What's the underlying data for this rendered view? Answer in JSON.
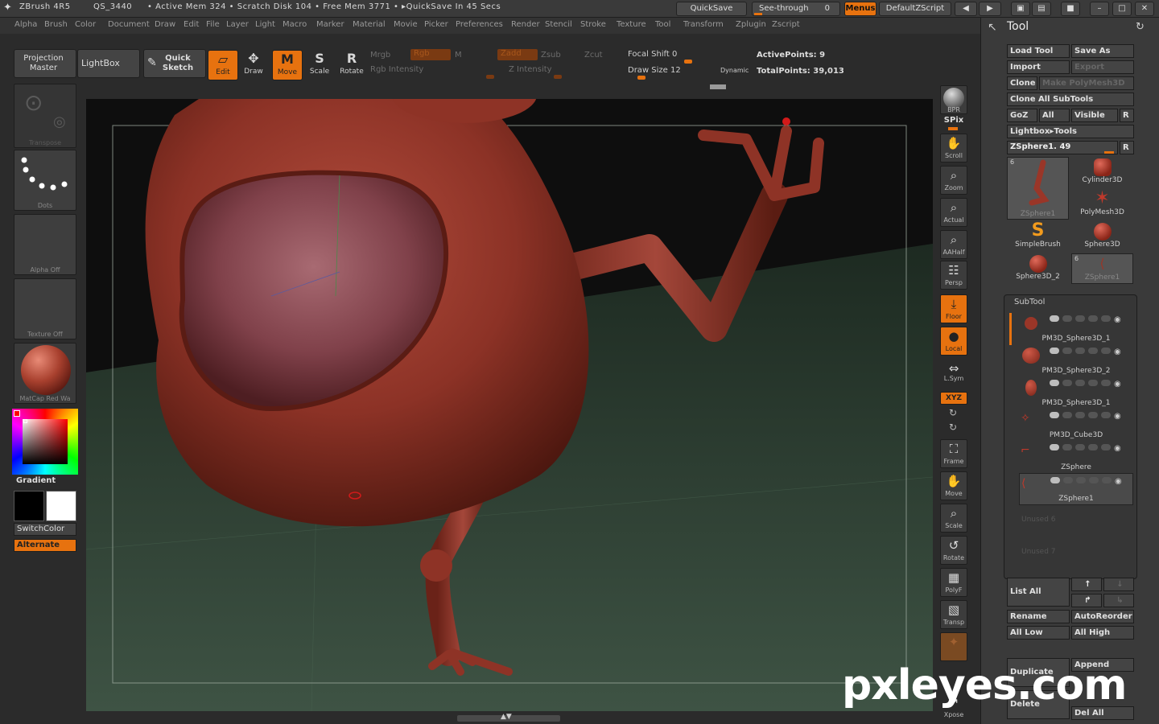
{
  "titlebar": {
    "app": "ZBrush 4R5",
    "doc": "QS_3440",
    "status": "• Active Mem 324 • Scratch Disk 104 • Free Mem 3771 • ▸QuickSave In 45 Secs",
    "quicksave": "QuickSave",
    "seethrough": "See-through",
    "seethrough_value": "0",
    "menus": "Menus",
    "defaultzscript": "DefaultZScript"
  },
  "menubar": [
    "Alpha",
    "Brush",
    "Color",
    "Document",
    "Draw",
    "Edit",
    "File",
    "Layer",
    "Light",
    "Macro",
    "Marker",
    "Material",
    "Movie",
    "Picker",
    "Preferences",
    "Render",
    "Stencil",
    "Stroke",
    "Texture",
    "Tool",
    "Transform",
    "Zplugin",
    "Zscript"
  ],
  "shelf": {
    "projection_master": "Projection Master",
    "lightbox": "LightBox",
    "quick_sketch": "Quick Sketch",
    "edit": "Edit",
    "draw": "Draw",
    "move": "Move",
    "scale": "Scale",
    "rotate": "Rotate",
    "mrgb": "Mrgb",
    "rgb": "Rgb",
    "m": "M",
    "rgb_intensity": "Rgb Intensity",
    "zadd": "Zadd",
    "zsub": "Zsub",
    "zcut": "Zcut",
    "z_intensity": "Z Intensity",
    "focal_shift": "Focal Shift",
    "focal_shift_value": "0",
    "draw_size": "Draw Size",
    "draw_size_value": "12",
    "dynamic": "Dynamic",
    "active_points": "ActivePoints: 9",
    "total_points": "TotalPoints: 39,013"
  },
  "leftpanel": {
    "transpose": "Transpose",
    "dots": "Dots",
    "alpha_off": "Alpha  Off",
    "texture_off": "Texture  Off",
    "matcap": "MatCap  Red  Wa",
    "gradient": "Gradient",
    "switchcolor": "SwitchColor",
    "alternate": "Alternate"
  },
  "rightdock": [
    {
      "label": "BPR",
      "icon": "bpr-sphere-icon",
      "active": false
    },
    {
      "label": "SPix",
      "icon": "spix-icon",
      "active": false
    },
    {
      "label": "Scroll",
      "icon": "scroll-hand-icon",
      "active": false
    },
    {
      "label": "Zoom",
      "icon": "zoom-icon",
      "active": false
    },
    {
      "label": "Actual",
      "icon": "actual-icon",
      "active": false
    },
    {
      "label": "AAHalf",
      "icon": "aahalf-icon",
      "active": false
    },
    {
      "label": "Persp",
      "icon": "perspective-icon",
      "active": false
    },
    {
      "label": "Floor",
      "icon": "floor-icon",
      "active": true
    },
    {
      "label": "Local",
      "icon": "local-icon",
      "active": true
    },
    {
      "label": "L.Sym",
      "icon": "lsym-icon",
      "active": false
    },
    {
      "label": "XYZ",
      "icon": "xyz-icon",
      "active": true
    },
    {
      "label": "Frame",
      "icon": "frame-icon",
      "active": false
    },
    {
      "label": "Move",
      "icon": "move-hand-icon",
      "active": false
    },
    {
      "label": "Scale",
      "icon": "scale-icon",
      "active": false
    },
    {
      "label": "Rotate",
      "icon": "rotate-icon",
      "active": false
    },
    {
      "label": "PolyF",
      "icon": "polyframe-icon",
      "active": false
    },
    {
      "label": "Transp",
      "icon": "transparency-icon",
      "active": false
    },
    {
      "label": "Xpose",
      "icon": "xpose-icon",
      "active": false
    }
  ],
  "tool": {
    "title": "Tool",
    "load_tool": "Load Tool",
    "save_as": "Save As",
    "import": "Import",
    "export": "Export",
    "clone": "Clone",
    "make_polymesh": "Make PolyMesh3D",
    "clone_all": "Clone  All  SubTools",
    "goz": "GoZ",
    "all": "All",
    "visible": "Visible",
    "r": "R",
    "lightbox_tools": "Lightbox▸Tools",
    "current_tool": "ZSphere1. 49",
    "thumbs": [
      {
        "label": "ZSphere1",
        "badge": "6"
      },
      {
        "label": "Cylinder3D",
        "badge": ""
      },
      {
        "label": "PolyMesh3D",
        "badge": ""
      },
      {
        "label": "SimpleBrush",
        "badge": ""
      },
      {
        "label": "Sphere3D",
        "badge": ""
      },
      {
        "label": "Sphere3D_2",
        "badge": ""
      },
      {
        "label": "ZSphere1",
        "badge": "6"
      }
    ],
    "subtool_title": "SubTool",
    "subtools": [
      "PM3D_Sphere3D_1",
      "PM3D_Sphere3D_2",
      "PM3D_Sphere3D_1",
      "PM3D_Cube3D",
      "ZSphere",
      "ZSphere1"
    ],
    "unused": [
      "Unused  6",
      "Unused  7"
    ],
    "list_all": "List  All",
    "rename": "Rename",
    "autoreorder": "AutoReorder",
    "all_low": "All  Low",
    "all_high": "All  High",
    "duplicate": "Duplicate",
    "append": "Append",
    "delete": "Delete",
    "del_all": "Del  All"
  },
  "watermark": "pxleyes.com",
  "colors": {
    "accent": "#e7720f",
    "model": "#8a2e22",
    "floor": "#2f3f33"
  }
}
